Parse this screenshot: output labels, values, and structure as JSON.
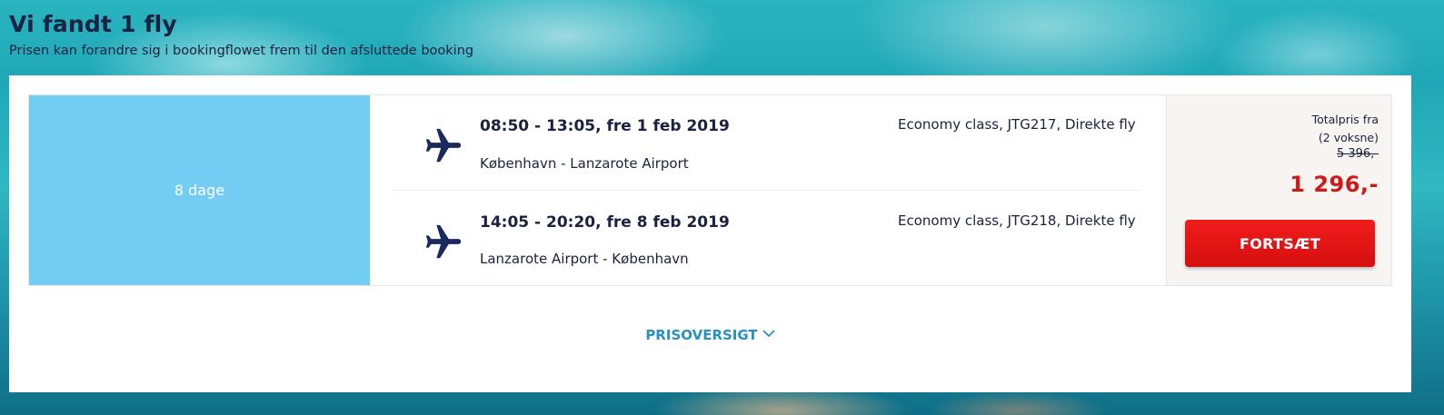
{
  "header": {
    "title": "Vi fandt 1 fly",
    "subtitle": "Prisen kan forandre sig i bookingflowet frem til den afsluttede booking"
  },
  "result": {
    "duration": "8 dage",
    "legs": [
      {
        "time": "08:50 - 13:05, fre 1 feb 2019",
        "route": "København - Lanzarote Airport",
        "details": "Economy class, JTG217, Direkte fly",
        "icon": "airplane-icon"
      },
      {
        "time": "14:05 - 20:20, fre 8 feb 2019",
        "route": "Lanzarote Airport - København",
        "details": "Economy class, JTG218, Direkte fly",
        "icon": "airplane-icon"
      }
    ],
    "price": {
      "label_line1": "Totalpris fra",
      "label_line2": "(2 voksne)",
      "old_price": "5 396,-",
      "new_price": "1 296,-",
      "continue_label": "FORTSÆT"
    },
    "price_overview_label": "PRISOVERSIGT"
  },
  "colors": {
    "duration_panel": "#73cdf3",
    "price_accent": "#cf1a1a",
    "button": "#e51414",
    "link": "#2a8fc2",
    "text": "#1b2140",
    "icon": "#1b2a5e"
  }
}
